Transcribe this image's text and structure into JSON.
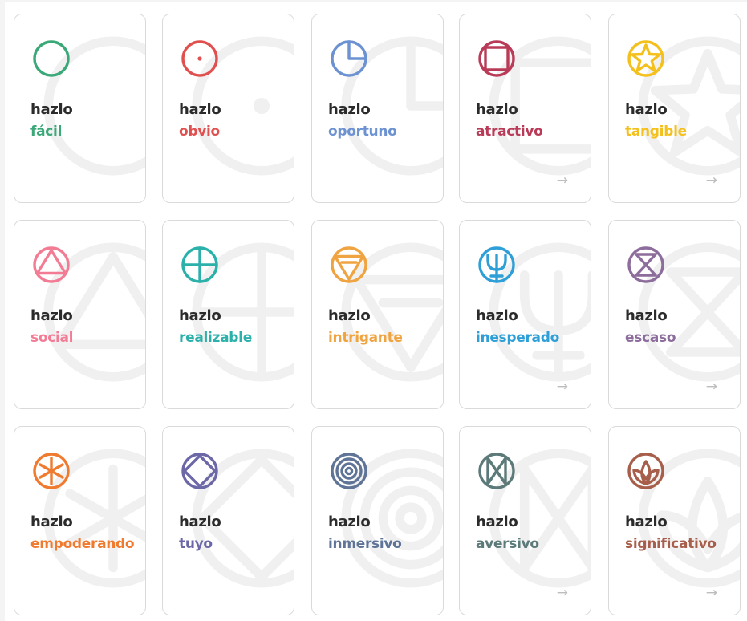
{
  "prefix": "hazlo",
  "arrow": "→",
  "cards": [
    {
      "word": "fácil",
      "color": "#3aa877",
      "icon": "circle-icon",
      "has_arrow": false
    },
    {
      "word": "obvio",
      "color": "#e0504f",
      "icon": "dotted-circle-icon",
      "has_arrow": false
    },
    {
      "word": "oportuno",
      "color": "#6c92d2",
      "icon": "clock-quarter-icon",
      "has_arrow": false
    },
    {
      "word": "atractivo",
      "color": "#b93b58",
      "icon": "square-circle-icon",
      "has_arrow": true
    },
    {
      "word": "tangible",
      "color": "#f4c01c",
      "icon": "star-circle-icon",
      "has_arrow": true
    },
    {
      "word": "social",
      "color": "#f37c95",
      "icon": "triangle-circle-icon",
      "has_arrow": false
    },
    {
      "word": "realizable",
      "color": "#2cb1aa",
      "icon": "cross-circle-icon",
      "has_arrow": false
    },
    {
      "word": "intrigante",
      "color": "#f0a441",
      "icon": "inverted-triangle-circle-icon",
      "has_arrow": false
    },
    {
      "word": "inesperado",
      "color": "#2f9fd7",
      "icon": "trident-circle-icon",
      "has_arrow": true
    },
    {
      "word": "escaso",
      "color": "#8d6d9c",
      "icon": "hourglass-circle-icon",
      "has_arrow": true
    },
    {
      "word": "empoderando",
      "color": "#f07a2e",
      "icon": "asterisk-circle-icon",
      "has_arrow": false
    },
    {
      "word": "tuyo",
      "color": "#6c68a8",
      "icon": "diamond-circle-icon",
      "has_arrow": false
    },
    {
      "word": "inmersivo",
      "color": "#5f7497",
      "icon": "concentric-circles-icon",
      "has_arrow": false
    },
    {
      "word": "aversivo",
      "color": "#5c7a79",
      "icon": "bowtie-circle-icon",
      "has_arrow": true
    },
    {
      "word": "significativo",
      "color": "#a75f4c",
      "icon": "lotus-circle-icon",
      "has_arrow": true
    }
  ]
}
